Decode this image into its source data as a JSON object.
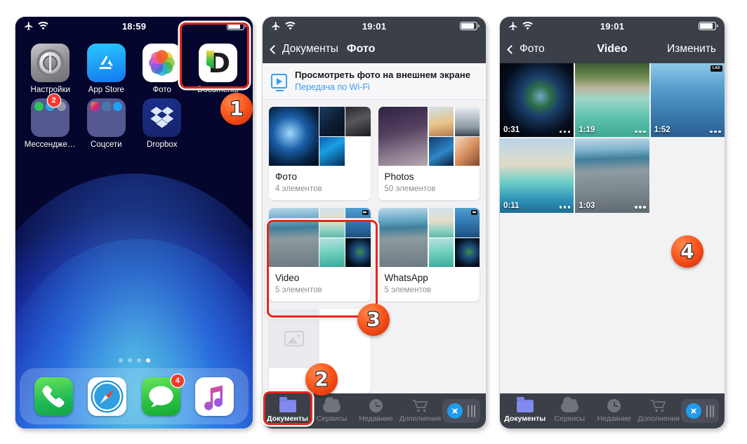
{
  "phone1": {
    "status": {
      "time": "18:59",
      "airplane_icon": "airplane-mode-icon",
      "wifi_icon": "wifi-icon",
      "battery_icon": "battery-icon"
    },
    "apps_row1": [
      {
        "label": "Настройки",
        "icon": "settings-gear-icon"
      },
      {
        "label": "App Store",
        "icon": "app-store-icon"
      },
      {
        "label": "Фото",
        "icon": "photos-icon"
      },
      {
        "label": "Documents",
        "icon": "documents-app-icon"
      }
    ],
    "apps_row2": [
      {
        "label": "Мессенджеры",
        "icon": "messengers-folder-icon",
        "badge": "2"
      },
      {
        "label": "Соцсети",
        "icon": "social-folder-icon",
        "badge": ""
      },
      {
        "label": "Dropbox",
        "icon": "dropbox-icon",
        "badge": ""
      }
    ],
    "dock": [
      {
        "label": "Телефон",
        "icon": "phone-icon",
        "badge": ""
      },
      {
        "label": "Safari",
        "icon": "safari-icon",
        "badge": ""
      },
      {
        "label": "Сообщения",
        "icon": "messages-icon",
        "badge": "4"
      },
      {
        "label": "Музыка",
        "icon": "music-icon",
        "badge": ""
      }
    ],
    "page_dots": 4,
    "page_active_index": 3
  },
  "phone2": {
    "status": {
      "time": "19:01"
    },
    "nav": {
      "back_label": "Документы",
      "title": "Фото"
    },
    "banner": {
      "title": "Просмотреть фото на внешнем экране",
      "link": "Передача по Wi-Fi",
      "icon": "airplay-display-icon"
    },
    "folders": [
      {
        "name": "Фото",
        "count": "4 элементов",
        "is_video": false
      },
      {
        "name": "Photos",
        "count": "50 элементов",
        "is_video": false
      },
      {
        "name": "Video",
        "count": "5 элементов",
        "is_video": true
      },
      {
        "name": "WhatsApp",
        "count": "5 элементов",
        "is_video": true
      }
    ],
    "tabs": [
      {
        "label": "Документы",
        "icon": "folder-icon",
        "active": true
      },
      {
        "label": "Сервисы",
        "icon": "cloud-icon",
        "active": false
      },
      {
        "label": "Недавние",
        "icon": "clock-icon",
        "active": false
      },
      {
        "label": "Дополнения",
        "icon": "cart-icon",
        "active": false
      }
    ],
    "browser_button": {
      "icon": "compass-icon",
      "handle": "drag-handle-icon"
    }
  },
  "phone3": {
    "status": {
      "time": "19:01"
    },
    "nav": {
      "back_label": "Фото",
      "title": "Video",
      "action": "Изменить"
    },
    "videos": [
      {
        "duration": "0:31",
        "tag": ""
      },
      {
        "duration": "1:19",
        "tag": ""
      },
      {
        "duration": "1:52",
        "tag": "LAD"
      },
      {
        "duration": "0:11",
        "tag": ""
      },
      {
        "duration": "1:03",
        "tag": ""
      }
    ],
    "tabs": [
      {
        "label": "Документы",
        "icon": "folder-icon",
        "active": true
      },
      {
        "label": "Сервисы",
        "icon": "cloud-icon",
        "active": false
      },
      {
        "label": "Недавние",
        "icon": "clock-icon",
        "active": false
      },
      {
        "label": "Дополнения",
        "icon": "cart-icon",
        "active": false
      }
    ],
    "browser_button": {
      "icon": "compass-icon",
      "handle": "drag-handle-icon"
    }
  },
  "callouts": [
    {
      "number": "1"
    },
    {
      "number": "2"
    },
    {
      "number": "3"
    },
    {
      "number": "4"
    }
  ],
  "colors": {
    "accent_red": "#e8261c",
    "callout_orange": "#fb5a20",
    "nav_dark": "#3a3f48",
    "link_blue": "#3a9bee",
    "badge_red": "#f5392c",
    "folder_purple": "#7b82e8"
  }
}
